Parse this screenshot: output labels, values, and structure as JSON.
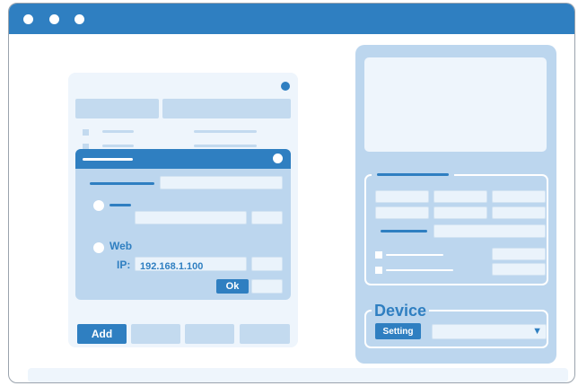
{
  "dialog": {
    "option_web_label": "Web",
    "ip_label": "IP:",
    "ip_value": "192.168.1.100",
    "ok_label": "Ok"
  },
  "left_panel": {
    "add_label": "Add"
  },
  "device_group": {
    "title": "Device",
    "setting_label": "Setting",
    "dropdown_arrow": "▼"
  },
  "colors": {
    "accent": "#2f7fc1",
    "panel": "#bcd6ee",
    "light_panel": "#eef5fc"
  }
}
